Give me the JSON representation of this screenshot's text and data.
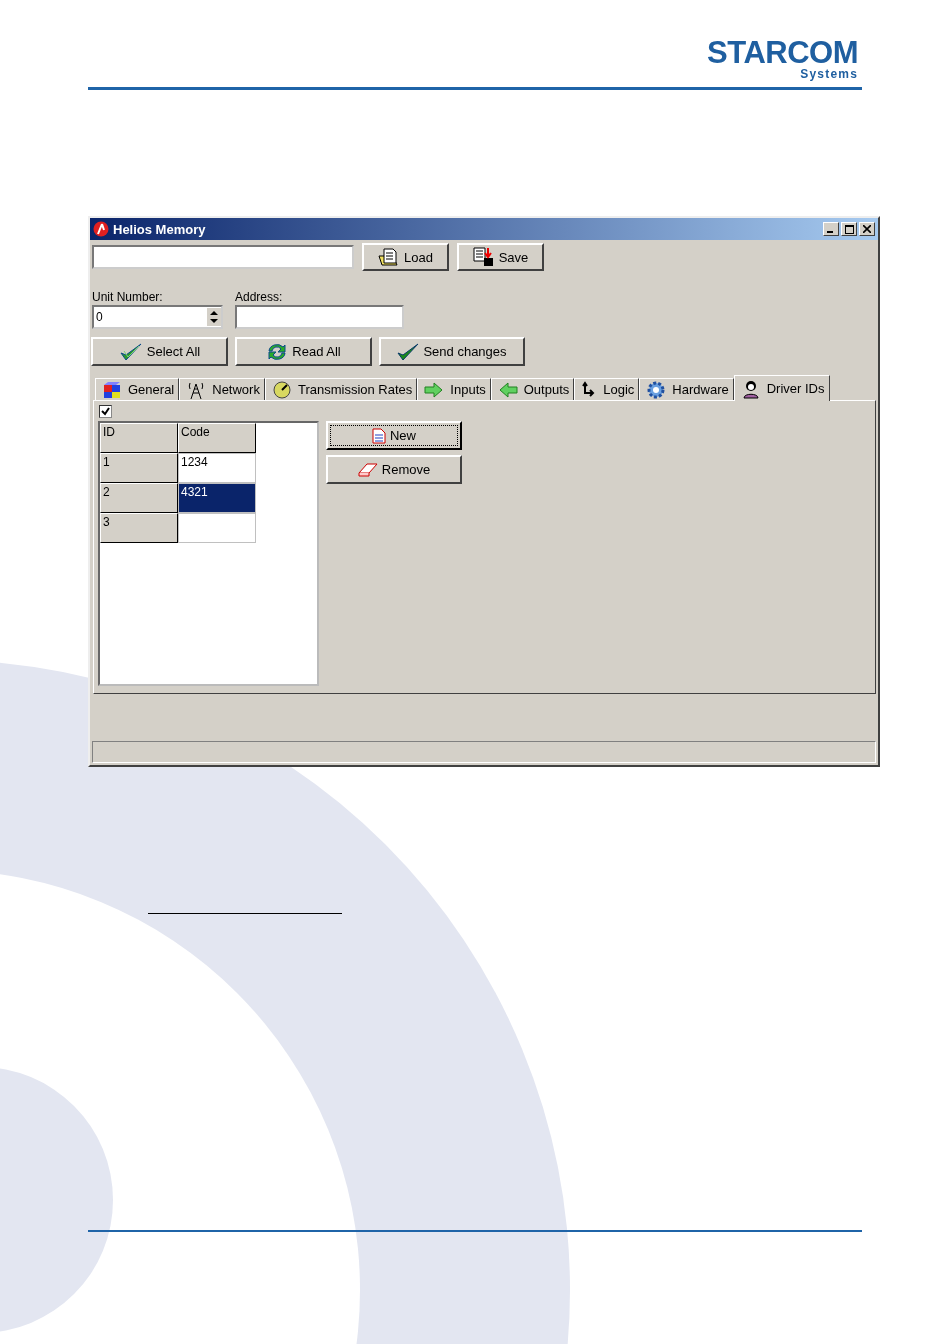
{
  "logo": {
    "name": "STARCOM",
    "tagline": "Systems"
  },
  "window": {
    "title": "Helios Memory"
  },
  "file_buttons": [
    {
      "label": "Load",
      "kind": "load"
    },
    {
      "label": "Save",
      "kind": "save"
    }
  ],
  "unit_number": {
    "label": "Unit Number:",
    "value": "0"
  },
  "address": {
    "label": "Address:"
  },
  "actions": [
    {
      "label": "Select All",
      "kind": "select"
    },
    {
      "label": "Read All",
      "kind": "read"
    },
    {
      "label": "Send changes",
      "kind": "send"
    }
  ],
  "tabs": [
    {
      "label": "General",
      "kind": "general",
      "selected": false
    },
    {
      "label": "Network",
      "kind": "network",
      "selected": false
    },
    {
      "label": "Transmission Rates",
      "kind": "rates",
      "selected": false
    },
    {
      "label": "Inputs",
      "kind": "inputs",
      "selected": false
    },
    {
      "label": "Outputs",
      "kind": "outputs",
      "selected": false
    },
    {
      "label": "Logic",
      "kind": "logic",
      "selected": false
    },
    {
      "label": "Hardware",
      "kind": "hardware",
      "selected": false
    },
    {
      "label": "Driver IDs",
      "kind": "drivers",
      "selected": true
    }
  ],
  "enabled_checkbox": {
    "checked": true
  },
  "grid": {
    "columns": [
      "ID",
      "Code"
    ],
    "rows": [
      {
        "id": "1",
        "code": "1234",
        "selected": false
      },
      {
        "id": "2",
        "code": "4321",
        "selected": true
      },
      {
        "id": "3",
        "selected": false
      }
    ]
  },
  "grid_buttons": [
    {
      "label": "New",
      "kind": "new",
      "focused": true
    },
    {
      "label": "Remove",
      "kind": "remove",
      "focused": false
    }
  ]
}
